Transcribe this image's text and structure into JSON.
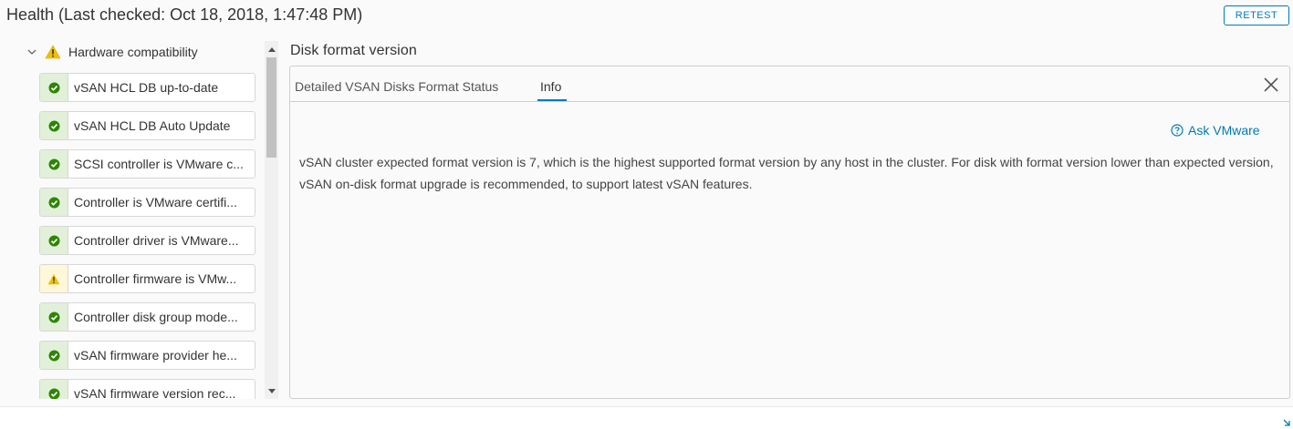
{
  "header": {
    "title": "Health (Last checked: Oct 18, 2018, 1:47:48 PM)",
    "retest_label": "RETEST"
  },
  "sidebar": {
    "group_label": "Hardware compatibility",
    "group_status": "warning",
    "items": [
      {
        "label": "vSAN HCL DB up-to-date",
        "status": "ok"
      },
      {
        "label": "vSAN HCL DB Auto Update",
        "status": "ok"
      },
      {
        "label": "SCSI controller is VMware c...",
        "status": "ok"
      },
      {
        "label": "Controller is VMware certifi...",
        "status": "ok"
      },
      {
        "label": "Controller driver is VMware...",
        "status": "ok"
      },
      {
        "label": "Controller firmware is VMw...",
        "status": "warning"
      },
      {
        "label": "Controller disk group mode...",
        "status": "ok"
      },
      {
        "label": "vSAN firmware provider he...",
        "status": "ok"
      },
      {
        "label": "vSAN firmware version rec...",
        "status": "ok"
      }
    ]
  },
  "detail": {
    "title": "Disk format version",
    "tabs": [
      {
        "label": "Detailed VSAN Disks Format Status",
        "active": false
      },
      {
        "label": "Info",
        "active": true
      }
    ],
    "ask_link": "Ask VMware",
    "info_text": "vSAN cluster expected format version is 7, which is the highest supported format version by any host in the cluster. For disk with format version lower than expected version, vSAN on-disk format upgrade is recommended, to support latest vSAN features."
  },
  "colors": {
    "accent": "#0079b8",
    "ok": "#2e8500",
    "warning": "#efc006"
  }
}
